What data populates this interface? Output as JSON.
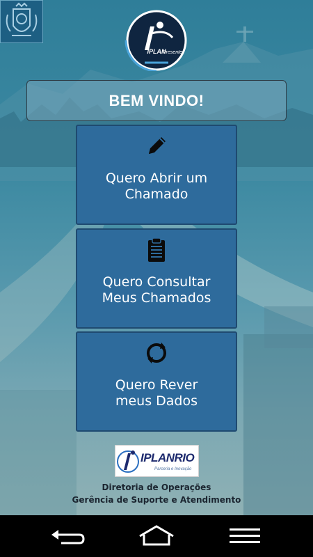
{
  "header": {
    "crest_name": "rio-city-crest",
    "logo": {
      "brand": "IPLAN",
      "sub": "Presente"
    }
  },
  "welcome": {
    "title": "BEM VINDO!"
  },
  "actions": [
    {
      "label_line1": "Quero Abrir um",
      "label_line2": "Chamado",
      "icon": "pencil-icon"
    },
    {
      "label_line1": "Quero Consultar",
      "label_line2": "Meus Chamados",
      "icon": "clipboard-icon"
    },
    {
      "label_line1": "Quero Rever",
      "label_line2": "meus Dados",
      "icon": "refresh-icon"
    }
  ],
  "footer": {
    "logo_brand": "IPLANRIO",
    "logo_tagline": "Parceria e Inovação",
    "dept_line1": "Diretoria de Operações",
    "dept_line2": "Gerência de Suporte e Atendimento"
  },
  "navigation": {
    "back": "back-icon",
    "home": "home-icon",
    "menu": "menu-icon"
  },
  "colors": {
    "card_bg": "#2e6b9c",
    "card_border": "#1f4a70",
    "background": "#3e8aa2",
    "navbar": "#000000"
  }
}
